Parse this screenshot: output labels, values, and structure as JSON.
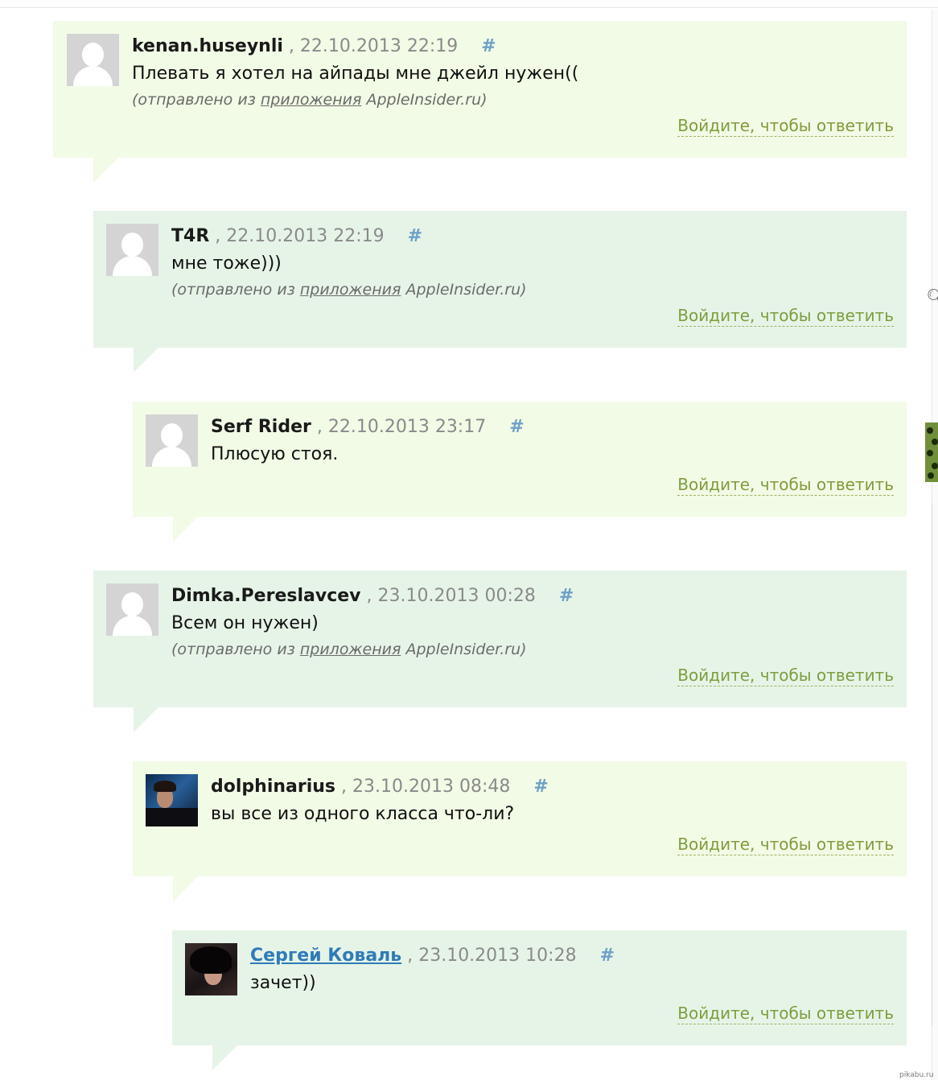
{
  "comments": [
    {
      "author": "kenan.huseynli",
      "separator": ",",
      "date": "22.10.2013 22:19",
      "hash": "#",
      "text": "Плевать я хотел на айпады мне джейл нужен((",
      "source": {
        "prefix": "(отправлено из ",
        "link": "приложения",
        "suffix": " AppleInsider.ru)"
      },
      "reply": "Войдите, чтобы ответить",
      "avatar": "default-user-avatar"
    },
    {
      "author": "T4R",
      "separator": ",",
      "date": "22.10.2013 22:19",
      "hash": "#",
      "text": "мне тоже)))",
      "source": {
        "prefix": "(отправлено из ",
        "link": "приложения",
        "suffix": " AppleInsider.ru)"
      },
      "reply": "Войдите, чтобы ответить",
      "avatar": "default-user-avatar"
    },
    {
      "author": "Serf Rider",
      "separator": ",",
      "date": "22.10.2013 23:17",
      "hash": "#",
      "text": "Плюсую стоя.",
      "reply": "Войдите, чтобы ответить",
      "avatar": "default-user-avatar"
    },
    {
      "author": "Dimka.Pereslavcev",
      "separator": ",",
      "date": "23.10.2013 00:28",
      "hash": "#",
      "text": "Всем он нужен)",
      "source": {
        "prefix": "(отправлено из ",
        "link": "приложения",
        "suffix": " AppleInsider.ru)"
      },
      "reply": "Войдите, чтобы ответить",
      "avatar": "default-user-avatar"
    },
    {
      "author": "dolphinarius",
      "separator": ",",
      "date": "23.10.2013 08:48",
      "hash": "#",
      "text": "вы все из одного класса что-ли?",
      "reply": "Войдите, чтобы ответить",
      "avatar": "user-photo-avatar"
    },
    {
      "author": "Сергей Коваль",
      "separator": ",",
      "date": "23.10.2013 10:28",
      "hash": "#",
      "text": "зачет))",
      "reply": "Войдите, чтобы ответить",
      "avatar": "user-photo-avatar"
    }
  ],
  "watermark": "pikabu.ru"
}
